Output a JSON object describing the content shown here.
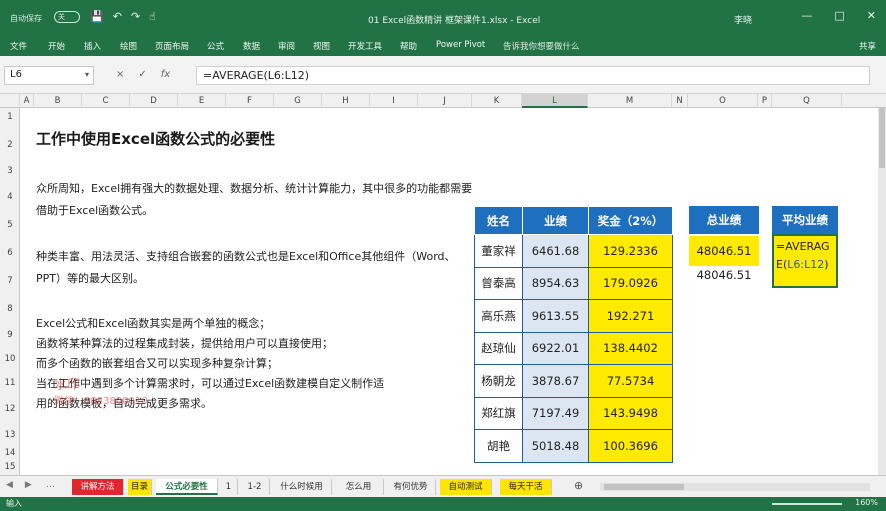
{
  "titlebar": {
    "autosave_label": "自动保存",
    "autosave_state": "关",
    "doc_title": "01 Excel函数精讲  框架课件1.xlsx  -  Excel",
    "user": "李晓",
    "qat_icons": [
      "save-icon",
      "undo-icon",
      "redo-icon",
      "touch-mode-icon"
    ],
    "window_controls": [
      "minimize-icon",
      "restore-icon",
      "close-icon"
    ]
  },
  "ribbon": {
    "tabs": [
      "文件",
      "开始",
      "插入",
      "绘图",
      "页面布局",
      "公式",
      "数据",
      "审阅",
      "视图",
      "开发工具",
      "帮助",
      "Power Pivot"
    ],
    "tell_me": "告诉我你想要做什么",
    "share": "共享"
  },
  "formula_bar": {
    "name_box": "L6",
    "cancel": "×",
    "enter": "✓",
    "fx": "fx",
    "formula": "=AVERAGE(L6:L12)"
  },
  "columns": [
    "A",
    "B",
    "C",
    "D",
    "E",
    "F",
    "G",
    "H",
    "I",
    "J",
    "K",
    "L",
    "M",
    "N",
    "O",
    "P",
    "Q"
  ],
  "rows": [
    "1",
    "2",
    "3",
    "4",
    "5",
    "6",
    "7",
    "8",
    "9",
    "10",
    "11",
    "12",
    "13",
    "14",
    "15"
  ],
  "content": {
    "title": "工作中使用Excel函数公式的必要性",
    "para1": "众所周知，Excel拥有强大的数据处理、数据分析、统计计算能力，其中很多的功能都需要借助于Excel函数公式。",
    "para2": "种类丰富、用法灵活、支持组合嵌套的函数公式也是Excel和Office其他组件（Word、PPT）等的最大区别。",
    "para3_lines": [
      "Excel公式和Excel函数其实是两个单独的概念；",
      "函数将某种算法的过程集成封装，提供给用户可以直接使用；",
      "而多个函数的嵌套组合又可以实现多种复杂计算；",
      "当在工作中遇到多个计算需求时，可以通过Excel函数建模自定义制作适",
      "用的函数模板，自动完成更多需求。"
    ]
  },
  "table": {
    "headers": [
      "姓名",
      "业绩",
      "奖金（2%）"
    ],
    "rows": [
      [
        "董家祥",
        "6461.68",
        "129.2336"
      ],
      [
        "曾泰高",
        "8954.63",
        "179.0926"
      ],
      [
        "高乐燕",
        "9613.55",
        "192.271"
      ],
      [
        "赵琼仙",
        "6922.01",
        "138.4402"
      ],
      [
        "杨朝龙",
        "3878.67",
        "77.5734"
      ],
      [
        "郑红旗",
        "7197.49",
        "143.9498"
      ],
      [
        "胡艳",
        "5018.48",
        "100.3696"
      ]
    ]
  },
  "summary": {
    "total_header": "总业绩",
    "total_value": "48046.51",
    "total_value_2": "48046.51",
    "avg_header": "平均业绩",
    "avg_formula_prefix": "=AVERAG",
    "avg_formula_suffix": "E(",
    "avg_formula_ref": "L6:L12",
    "avg_formula_close": ")"
  },
  "watermark": {
    "line1": "水印",
    "line2": "微信：9883800010"
  },
  "sheet_tabs": [
    {
      "label": "讲解方法",
      "style": "red"
    },
    {
      "label": "目录",
      "style": "yellow"
    },
    {
      "label": "公式必要性",
      "style": "active"
    },
    {
      "label": "1",
      "style": "normal"
    },
    {
      "label": "1-2",
      "style": "normal"
    },
    {
      "label": "什么时候用",
      "style": "normal"
    },
    {
      "label": "怎么用",
      "style": "normal"
    },
    {
      "label": "有何优势",
      "style": "normal"
    },
    {
      "label": "自动测试",
      "style": "yellow"
    },
    {
      "label": "每天干活",
      "style": "yellow"
    }
  ],
  "statusbar": {
    "mode": "输入",
    "zoom": "160%"
  },
  "colors": {
    "excel_green": "#217346",
    "header_blue": "#1f6fbf",
    "highlight_yellow": "#ffea00",
    "score_blue": "#dce6f2"
  }
}
